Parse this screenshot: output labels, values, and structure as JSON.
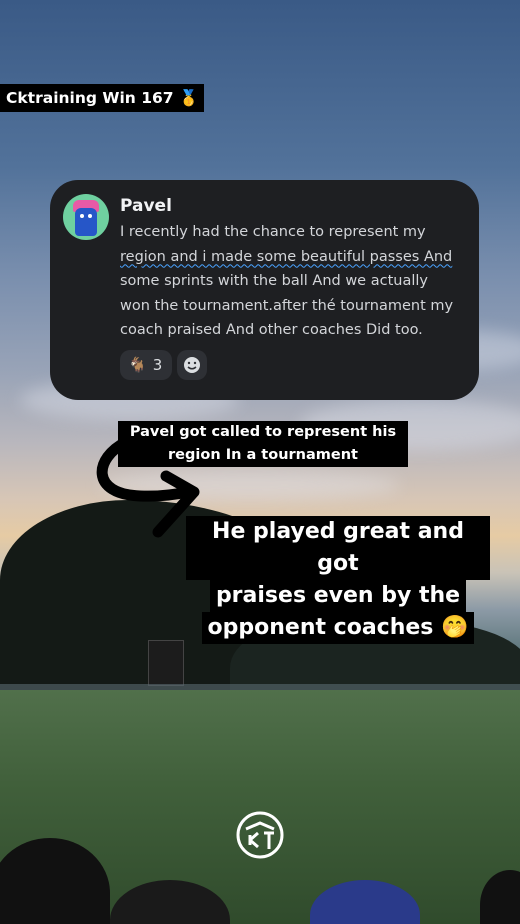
{
  "header_tag": {
    "text": "Cktraining Win 167 🥇"
  },
  "message_card": {
    "username": "Pavel",
    "lines": [
      "I recently had the chance to represent my",
      "region and i made some beautiful passes And",
      "some sprints with the ball And we actually",
      "won the tournament.after thé tournament my",
      "coach praised And other coaches Did too."
    ],
    "reactions": [
      {
        "emoji": "🐐",
        "count": "3"
      }
    ],
    "add_reaction_icon": "smiley-add-icon"
  },
  "caption_small": {
    "line1": "Pavel got called to represent his",
    "line2": "region In a tournament"
  },
  "caption_large": {
    "line1": "He played great and got",
    "line2": "praises even by the",
    "line3": "opponent coaches 🤭"
  },
  "colors": {
    "card_bg": "#1e1f22",
    "caption_bg": "#000000",
    "underline": "#4aa3ff"
  },
  "brand_logo": "circular-ck-logo"
}
